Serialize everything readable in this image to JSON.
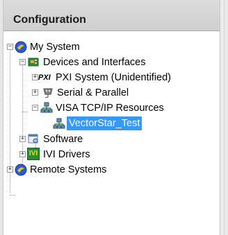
{
  "panel": {
    "title": "Configuration"
  },
  "tree": [
    {
      "label": "My System",
      "expanded": true,
      "icon": "ni-logo-icon"
    },
    {
      "label": "Devices and Interfaces",
      "expanded": true,
      "icon": "device-board-icon"
    },
    {
      "label": "PXI System (Unidentified)",
      "expanded": false,
      "icon": "pxi-icon"
    },
    {
      "label": "Serial & Parallel",
      "expanded": false,
      "icon": "serial-port-icon"
    },
    {
      "label": "VISA TCP/IP Resources",
      "expanded": true,
      "icon": "network-icon"
    },
    {
      "label": "VectorStar_Test",
      "selected": true,
      "icon": "network-icon"
    },
    {
      "label": "Software",
      "expanded": false,
      "icon": "software-icon"
    },
    {
      "label": "IVI Drivers",
      "expanded": false,
      "icon": "ivi-icon"
    },
    {
      "label": "Remote Systems",
      "expanded": false,
      "icon": "ni-logo-icon"
    }
  ],
  "expander_symbols": {
    "expanded": "−",
    "collapsed": "+"
  },
  "pxi_icon_text": "PXI",
  "ivi_icon_text": "IVI",
  "colors": {
    "selection": "#3399ff",
    "header_bg": "#d4d4d4",
    "ni_blue": "#2a5bd7",
    "ni_yellow": "#f2c200",
    "board_green": "#2e8b3a"
  }
}
